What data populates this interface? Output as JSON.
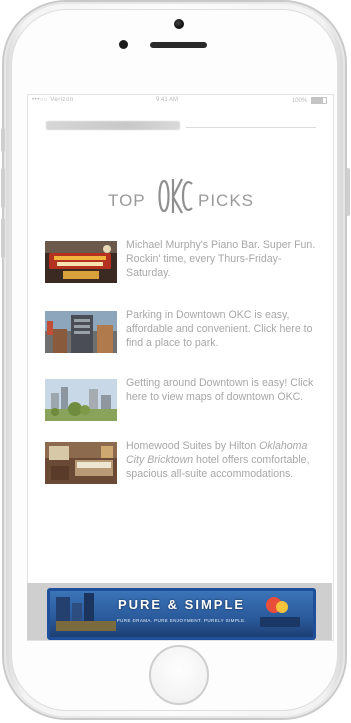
{
  "status_bar": {
    "carrier": "•••○○ Verizon",
    "time": "9:41 AM",
    "battery": "100%"
  },
  "header": {
    "title_left": "TOP",
    "title_logo": "OKC",
    "title_right": "PICKS"
  },
  "picks": [
    {
      "text": "Michael Murphy's Piano Bar. Super Fun. Rockin' time, every Thurs-Friday-Saturday.",
      "thumb": "piano-bar-sign"
    },
    {
      "text": "Parking in Downtown OKC is easy, affordable and convenient. Click here to find a place to park.",
      "thumb": "parking-garage"
    },
    {
      "text": "Getting around Downtown is easy! Click here to view maps of downtown OKC.",
      "thumb": "downtown-skyline"
    },
    {
      "text_pre": "Homewood Suites by Hilton ",
      "text_em": "Oklahoma City Bricktown",
      "text_post": " hotel offers comfortable, spacious all-suite accommodations.",
      "thumb": "hotel-room"
    }
  ],
  "banner": {
    "headline": "PURE & SIMPLE",
    "tagline": "PURE DRAMA. PURE ENJOYMENT. PURELY SIMPLE.",
    "brand_color": "#1f4e9b"
  }
}
